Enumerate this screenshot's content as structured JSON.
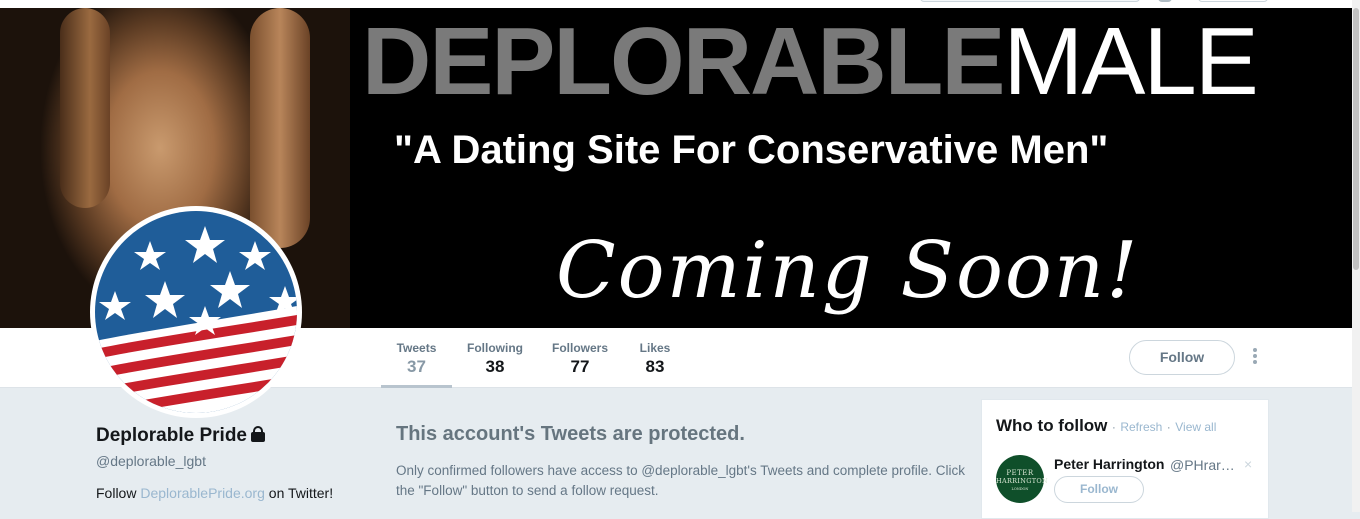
{
  "banner": {
    "brand_part1": "DEPLORABLE",
    "brand_part2": "MALE",
    "tagline": "\"A Dating Site For Conservative Men\"",
    "coming_soon": "Coming Soon!"
  },
  "nav": {
    "items": [
      {
        "label": "Tweets",
        "value": "37"
      },
      {
        "label": "Following",
        "value": "38"
      },
      {
        "label": "Followers",
        "value": "77"
      },
      {
        "label": "Likes",
        "value": "83"
      }
    ],
    "follow_label": "Follow"
  },
  "profile": {
    "name": "Deplorable Pride",
    "handle": "@deplorable_lgbt",
    "bio_prefix": "Follow",
    "bio_link": "DeplorablePride.org",
    "bio_suffix": "on Twitter!",
    "avatar_icon": "us-flag-globe-icon"
  },
  "protected": {
    "title": "This account's Tweets are protected.",
    "text": "Only confirmed followers have access to @deplorable_lgbt's Tweets and complete profile. Click the \"Follow\" button to send a follow request."
  },
  "who_to_follow": {
    "title": "Who to follow",
    "separator": "·",
    "refresh": "Refresh",
    "view_all": "View all",
    "suggestion": {
      "name": "Peter Harrington",
      "handle": "@PHrarebooks",
      "avatar_line1": "PETER",
      "avatar_line2": "HARRINGTON",
      "avatar_line3": "LONDON",
      "follow_label": "Follow",
      "close_glyph": "×"
    }
  },
  "colors": {
    "accent_link": "#9ab7cf",
    "banner_bg": "#000000",
    "page_bg": "#e6ecf0"
  }
}
